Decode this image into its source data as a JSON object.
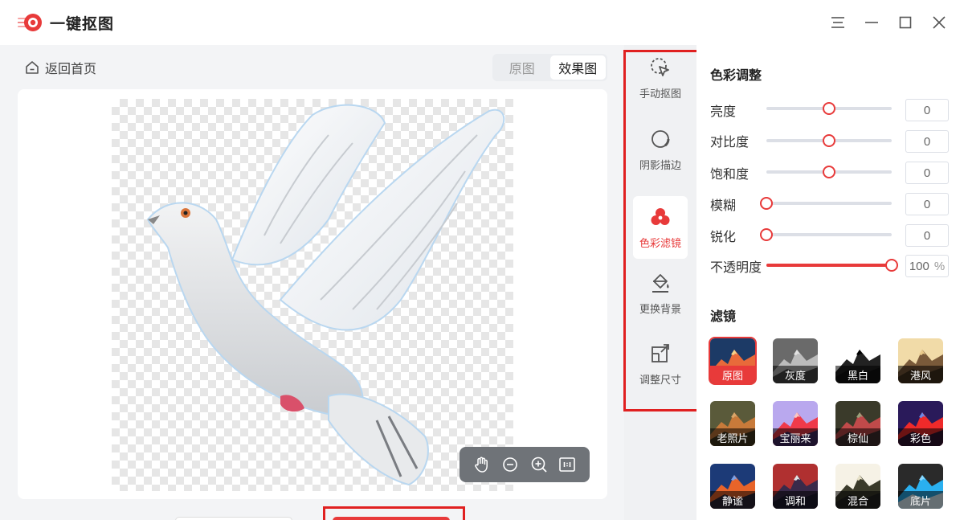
{
  "app": {
    "title": "一键抠图"
  },
  "window": {
    "controls": [
      "menu-icon",
      "minimize-icon",
      "maximize-icon",
      "close-icon"
    ]
  },
  "nav": {
    "back_label": "返回首页"
  },
  "view_toggle": {
    "options": [
      "原图",
      "效果图"
    ],
    "selected": "效果图"
  },
  "canvas": {
    "subject": "dove-cutout",
    "background": "transparent-checkerboard"
  },
  "zoom_tools": [
    "hand-icon",
    "zoom-out-icon",
    "zoom-in-icon",
    "fit-icon"
  ],
  "tools": [
    {
      "label": "手动抠图",
      "icon": "cursor-select-icon",
      "active": false
    },
    {
      "label": "阴影描边",
      "icon": "shadow-outline-icon",
      "active": false
    },
    {
      "label": "色彩滤镜",
      "icon": "color-filter-icon",
      "active": true
    },
    {
      "label": "更换背景",
      "icon": "paint-bucket-icon",
      "active": false
    },
    {
      "label": "调整尺寸",
      "icon": "resize-icon",
      "active": false
    }
  ],
  "color_adjust": {
    "title": "色彩调整",
    "items": [
      {
        "label": "亮度",
        "value": "0",
        "level": 0.5
      },
      {
        "label": "对比度",
        "value": "0",
        "level": 0.5
      },
      {
        "label": "饱和度",
        "value": "0",
        "level": 0.5
      },
      {
        "label": "模糊",
        "value": "0",
        "level": 0
      },
      {
        "label": "锐化",
        "value": "0",
        "level": 0
      },
      {
        "label": "不透明度",
        "value": "100",
        "unit": "%",
        "level": 1
      }
    ]
  },
  "filters": {
    "title": "滤镜",
    "items": [
      {
        "label": "原图",
        "selected": true
      },
      {
        "label": "灰度"
      },
      {
        "label": "黑白"
      },
      {
        "label": "港风"
      },
      {
        "label": "老照片"
      },
      {
        "label": "宝丽来"
      },
      {
        "label": "棕仙"
      },
      {
        "label": "彩色"
      },
      {
        "label": "静谧"
      },
      {
        "label": "调和"
      },
      {
        "label": "混合"
      },
      {
        "label": "底片"
      }
    ]
  },
  "colors": {
    "accent": "#e83a3a",
    "highlight_box": "#e02020"
  }
}
